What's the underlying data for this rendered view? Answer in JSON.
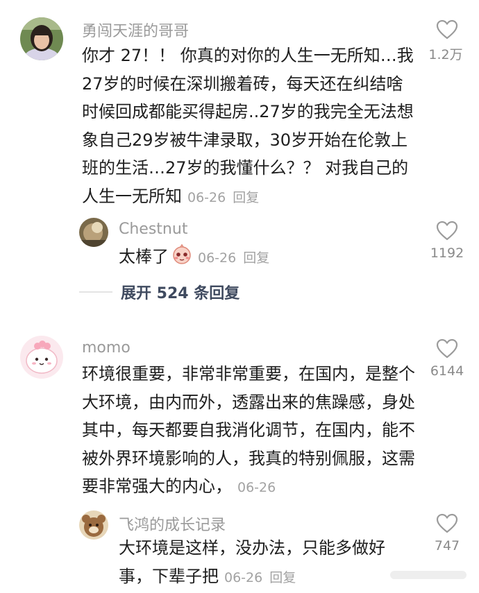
{
  "comments": [
    {
      "username": "勇闯天涯的哥哥",
      "text": "你才 27！！ 你真的对你的人生一无所知…我27岁的时候在深圳搬着砖，每天还在纠结啥时候回成都能买得起房..27岁的我完全无法想象自己29岁被牛津录取，30岁开始在伦敦上班的生活…27岁的我懂什么？？ 对我自己的人生一无所知",
      "date": "06-26",
      "reply_label": "回复",
      "likes": "1.2万",
      "replies": [
        {
          "username": "Chestnut",
          "text": "太棒了",
          "sticker": "blushing-face-sticker",
          "date": "06-26",
          "reply_label": "回复",
          "likes": "1192"
        }
      ],
      "expand_label": "展开 524 条回复"
    },
    {
      "username": "momo",
      "text": "环境很重要，非常非常重要，在国内，是整个大环境，由内而外，透露出来的焦躁感，身处其中，每天都要自我消化调节，在国内，能不被外界环境影响的人，我真的特别佩服，这需要非常强大的内心，",
      "date": "06-26",
      "likes": "6144",
      "replies": [
        {
          "username": "飞鸿的成长记录",
          "text": "大环境是这样，没办法，只能多做好事，下辈子把",
          "date": "06-26",
          "reply_label": "回复",
          "likes": "747"
        }
      ]
    }
  ],
  "icons": {
    "like": "heart-outline-icon"
  },
  "colors": {
    "username": "#9a9a9a",
    "meta": "#a2a2a2",
    "expand": "#3f4a5f",
    "body_text": "#1e1e1e"
  }
}
